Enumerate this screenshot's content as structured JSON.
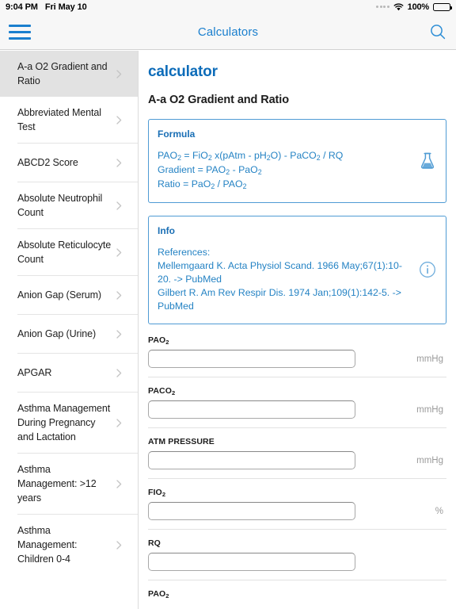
{
  "statusbar": {
    "time": "9:04 PM",
    "date": "Fri May 10",
    "battery_percent": "100%",
    "wifi_icon": "wifi-icon",
    "battery_icon": "battery-full-icon",
    "signal_icon": "signal-dots-icon"
  },
  "navbar": {
    "title": "Calculators",
    "menu_icon": "hamburger-menu-icon",
    "search_icon": "search-icon",
    "accent_color": "#1a7fce"
  },
  "sidebar": {
    "items": [
      {
        "label": "A-a O2 Gradient and Ratio",
        "selected": true
      },
      {
        "label": "Abbreviated Mental Test",
        "selected": false
      },
      {
        "label": "ABCD2 Score",
        "selected": false
      },
      {
        "label": "Absolute Neutrophil Count",
        "selected": false
      },
      {
        "label": "Absolute Reticulocyte Count",
        "selected": false
      },
      {
        "label": "Anion Gap (Serum)",
        "selected": false
      },
      {
        "label": "Anion Gap (Urine)",
        "selected": false
      },
      {
        "label": "APGAR",
        "selected": false
      },
      {
        "label": "Asthma Management During Pregnancy and Lactation",
        "selected": false
      },
      {
        "label": "Asthma Management: >12 years",
        "selected": false
      },
      {
        "label": "Asthma Management: Children 0-4",
        "selected": false
      }
    ]
  },
  "main": {
    "kicker": "calculator",
    "title": "A-a O2 Gradient and Ratio",
    "formula_card": {
      "heading": "Formula",
      "icon": "flask-icon",
      "lines": [
        "PAO<sub>2</sub> = FiO<sub>2</sub> x(pAtm - pH<sub>2</sub>O) - PaCO<sub>2</sub> / RQ",
        "Gradient = PAO<sub>2</sub> - PaO<sub>2</sub>",
        "Ratio = PaO<sub>2</sub> / PAO<sub>2</sub>"
      ]
    },
    "info_card": {
      "heading": "Info",
      "icon": "info-circle-icon",
      "lines": [
        "References:",
        "Mellemgaard K. Acta Physiol Scand. 1966 May;67(1):10-20. -> PubMed",
        "Gilbert R. Am Rev Respir Dis. 1974 Jan;109(1):142-5. -> PubMed"
      ]
    },
    "fields": [
      {
        "label": "PAO<sub>2</sub>",
        "value": "",
        "unit": "mmHg",
        "has_input": true
      },
      {
        "label": "PACO<sub>2</sub>",
        "value": "",
        "unit": "mmHg",
        "has_input": true
      },
      {
        "label": "ATM PRESSURE",
        "value": "",
        "unit": "mmHg",
        "has_input": true
      },
      {
        "label": "FIO<sub>2</sub>",
        "value": "",
        "unit": "%",
        "has_input": true
      },
      {
        "label": "RQ",
        "value": "",
        "unit": "",
        "has_input": true
      },
      {
        "label": "PAO<sub>2</sub>",
        "value": "",
        "unit": "",
        "has_input": false
      }
    ]
  },
  "colors": {
    "accent_blue": "#1a7fce",
    "heading_blue": "#0d6cb9",
    "card_border_blue": "#4f9bd4",
    "card_text_blue": "#2583c4",
    "selected_row": "#e2e2e2"
  }
}
